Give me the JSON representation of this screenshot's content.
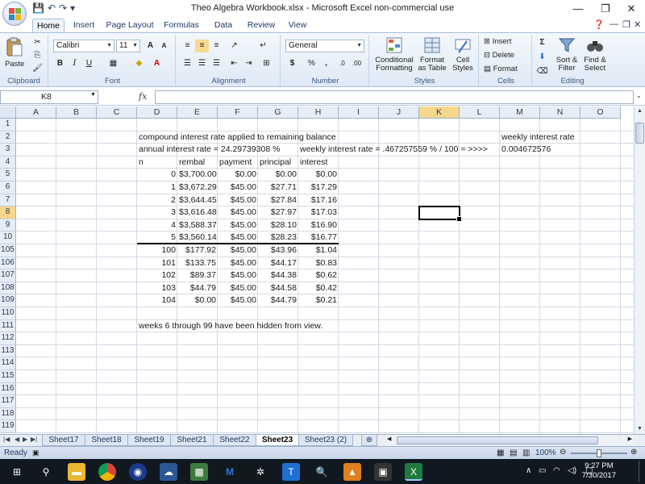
{
  "window": {
    "title": "Theo Algebra Workbook.xlsx - Microsoft Excel non-commercial use",
    "minimize": "—",
    "restore": "❐",
    "close": "✕"
  },
  "qat": {
    "save": "💾",
    "undo": "↶",
    "redo": "↷",
    "more": "▾"
  },
  "tabs": [
    "Home",
    "Insert",
    "Page Layout",
    "Formulas",
    "Data",
    "Review",
    "View"
  ],
  "active_tab": "Home",
  "ribbon": {
    "clipboard": {
      "label": "Clipboard",
      "paste": "Paste"
    },
    "font": {
      "label": "Font",
      "name": "Calibri",
      "size": "11",
      "bold": "B",
      "italic": "I",
      "underline": "U",
      "grow": "A",
      "shrink": "A"
    },
    "alignment": {
      "label": "Alignment"
    },
    "number": {
      "label": "Number",
      "format": "General",
      "currency": "$",
      "percent": "%",
      "comma": ",",
      "inc_dec": ".0",
      "dec_dec": ".00"
    },
    "styles": {
      "label": "Styles",
      "conditional": "Conditional Formatting",
      "format_table": "Format as Table",
      "cell_styles": "Cell Styles"
    },
    "cells": {
      "label": "Cells",
      "insert": "Insert",
      "delete": "Delete",
      "format": "Format"
    },
    "editing": {
      "label": "Editing",
      "sort": "Sort & Filter",
      "find": "Find & Select"
    }
  },
  "formula_bar": {
    "name_box": "K8",
    "fx": "fx",
    "value": ""
  },
  "columns": [
    "A",
    "B",
    "C",
    "D",
    "E",
    "F",
    "G",
    "H",
    "I",
    "J",
    "K",
    "L",
    "M",
    "N",
    "O"
  ],
  "selected_column": "K",
  "rows": [
    "1",
    "2",
    "3",
    "4",
    "5",
    "6",
    "7",
    "8",
    "9",
    "10",
    "105",
    "106",
    "107",
    "108",
    "109",
    "110",
    "111",
    "112",
    "113",
    "114",
    "115",
    "116",
    "117",
    "118",
    "119"
  ],
  "selected_row": "8",
  "cells": {
    "D2": "compound interest rate applied to remaining balance",
    "M2": "weekly interest rate",
    "D3": "annual interest rate = 24.29739308 %",
    "H3": "weekly interest rate = .467257559 % / 100 = >>>>",
    "M3": "0.004672576",
    "D4": "n",
    "E4": "rembal",
    "F4": "payment",
    "G4": "principal",
    "H4": "interest",
    "D111": "weeks 6 through 99 have been hidden from view."
  },
  "table": [
    [
      "0",
      "$3,700.00",
      "$0.00",
      "$0.00",
      "$0.00"
    ],
    [
      "1",
      "$3,672.29",
      "$45.00",
      "$27.71",
      "$17.29"
    ],
    [
      "2",
      "$3,644.45",
      "$45.00",
      "$27.84",
      "$17.16"
    ],
    [
      "3",
      "$3,616.48",
      "$45.00",
      "$27.97",
      "$17.03"
    ],
    [
      "4",
      "$3,588.37",
      "$45.00",
      "$28.10",
      "$16.90"
    ],
    [
      "5",
      "$3,560.14",
      "$45.00",
      "$28.23",
      "$16.77"
    ],
    [
      "100",
      "$177.92",
      "$45.00",
      "$43.96",
      "$1.04"
    ],
    [
      "101",
      "$133.75",
      "$45.00",
      "$44.17",
      "$0.83"
    ],
    [
      "102",
      "$89.37",
      "$45.00",
      "$44.38",
      "$0.62"
    ],
    [
      "103",
      "$44.79",
      "$45.00",
      "$44.58",
      "$0.42"
    ],
    [
      "104",
      "$0.00",
      "$45.00",
      "$44.79",
      "$0.21"
    ]
  ],
  "sheets": [
    "Sheet17",
    "Sheet18",
    "Sheet19",
    "Sheet21",
    "Sheet22",
    "Sheet23",
    "Sheet23 (2)"
  ],
  "active_sheet": "Sheet23",
  "status": {
    "mode": "Ready",
    "zoom": "100%"
  },
  "taskbar": {
    "time": "9:27 PM",
    "date": "7/30/2017",
    "apps": [
      "windows-start",
      "search",
      "file-explorer",
      "chrome",
      "firefox-dev",
      "settings-app",
      "photos",
      "malwarebytes",
      "network",
      "trello",
      "search-tool",
      "vlc",
      "terminal",
      "excel"
    ]
  }
}
